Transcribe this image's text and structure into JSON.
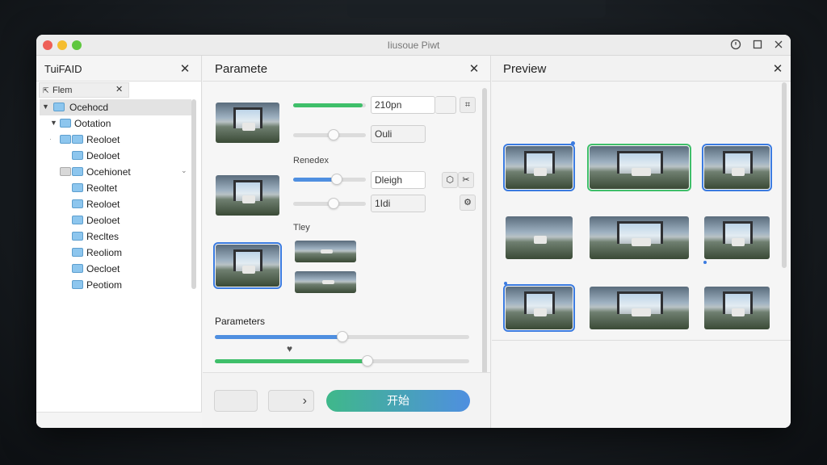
{
  "window": {
    "title": "Iiusoue Piwt",
    "controls": [
      "clock-icon",
      "maximize-icon",
      "close-icon"
    ]
  },
  "left_panel": {
    "title": "TuiFAID",
    "tab_label": "Flem",
    "tree": [
      {
        "label": "Ocehocd",
        "level": 0,
        "expanded": true,
        "selected": true
      },
      {
        "label": "Ootation",
        "level": 1,
        "expanded": true
      },
      {
        "label": "Reoloet",
        "level": 2,
        "expanded": false
      },
      {
        "label": "Deoloet",
        "level": 2
      },
      {
        "label": "Ocehionet",
        "level": 2,
        "has_chevron": true
      },
      {
        "label": "Reoltet",
        "level": 2
      },
      {
        "label": "Reoloet",
        "level": 2
      },
      {
        "label": "Deoloet",
        "level": 2
      },
      {
        "label": "Recltes",
        "level": 2
      },
      {
        "label": "Reoliom",
        "level": 2
      },
      {
        "label": "Oecloet",
        "level": 2
      },
      {
        "label": "Peotiom",
        "level": 2
      }
    ]
  },
  "mid_panel": {
    "title": "Paramete",
    "row1": {
      "value": "210pn",
      "value2": "Ouli",
      "slider1": 0.95,
      "slider2": 0.55
    },
    "section_renedex": "Renedex",
    "row2": {
      "value": "Dleigh",
      "value2": "1Idi",
      "slider1": 0.6,
      "slider2": 0.55
    },
    "section_tiey": "Tley",
    "section_parameters": "Parameters",
    "slider_a": 0.5,
    "slider_b": 0.6,
    "start_label": "开始",
    "next_glyph": "›",
    "colors": {
      "green": "#3fbf6a",
      "blue": "#4f8fe0"
    }
  },
  "right_panel": {
    "title": "Preview"
  }
}
